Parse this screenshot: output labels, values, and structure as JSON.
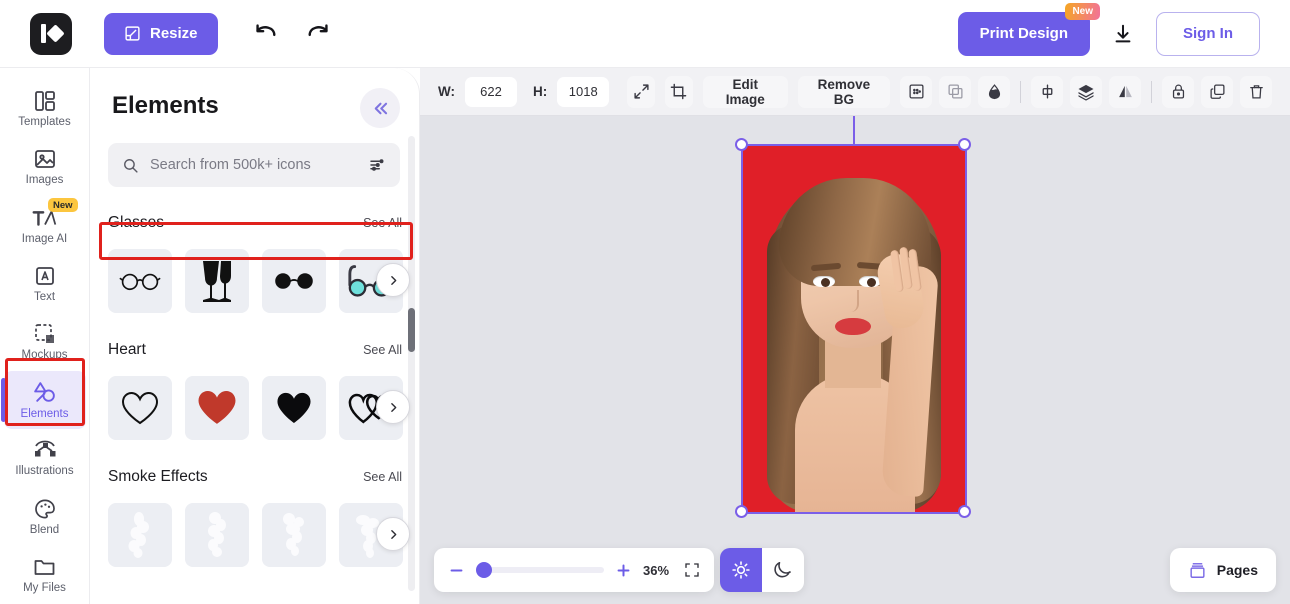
{
  "topbar": {
    "logo_name": "app-logo",
    "resize_label": "Resize",
    "undo_icon": "undo-icon",
    "redo_icon": "redo-icon",
    "print_label": "Print Design",
    "print_badge": "New",
    "download_icon": "download-icon",
    "signin_label": "Sign In"
  },
  "rail": {
    "items": [
      {
        "label": "Templates",
        "icon": "templates-icon",
        "active": false,
        "badge": ""
      },
      {
        "label": "Images",
        "icon": "images-icon",
        "active": false,
        "badge": ""
      },
      {
        "label": "Image AI",
        "icon": "image-ai-icon",
        "active": false,
        "badge": "New"
      },
      {
        "label": "Text",
        "icon": "text-icon",
        "active": false,
        "badge": ""
      },
      {
        "label": "Mockups",
        "icon": "mockups-icon",
        "active": false,
        "badge": ""
      },
      {
        "label": "Elements",
        "icon": "elements-icon",
        "active": true,
        "badge": ""
      },
      {
        "label": "Illustrations",
        "icon": "illustrations-icon",
        "active": false,
        "badge": ""
      },
      {
        "label": "Blend",
        "icon": "blend-icon",
        "active": false,
        "badge": ""
      },
      {
        "label": "My Files",
        "icon": "my-files-icon",
        "active": false,
        "badge": ""
      }
    ]
  },
  "panel": {
    "title": "Elements",
    "collapse_icon": "double-chevron-left-icon",
    "search": {
      "placeholder": "Search from 500k+ icons",
      "value": "",
      "search_icon": "search-icon",
      "filter_icon": "filter-sliders-icon"
    },
    "sections": [
      {
        "name": "Glasses",
        "see_all": "See All",
        "tiles": [
          "round-glasses-icon",
          "wine-glasses-icon",
          "sunglasses-icon",
          "cyan-glasses-icon"
        ]
      },
      {
        "name": "Heart",
        "see_all": "See All",
        "tiles": [
          "heart-outline-icon",
          "heart-red-icon",
          "heart-black-icon",
          "double-heart-icon"
        ]
      },
      {
        "name": "Smoke Effects",
        "see_all": "See All",
        "tiles": [
          "smoke-1-icon",
          "smoke-2-icon",
          "smoke-3-icon",
          "smoke-4-icon"
        ]
      }
    ]
  },
  "canvas_toolbar": {
    "width_label": "W:",
    "width_value": "622",
    "height_label": "H:",
    "height_value": "1018",
    "expand_icon": "expand-arrows-icon",
    "crop_icon": "crop-icon",
    "edit_image_label": "Edit Image",
    "remove_bg_label": "Remove BG",
    "right_icons": [
      "shadow-icon",
      "duplicate-overlap-icon",
      "opacity-droplet-icon",
      "align-icon",
      "layers-icon",
      "flip-icon",
      "lock-icon",
      "copy-icon",
      "trash-icon"
    ]
  },
  "canvas": {
    "background_color": "#e2e3e8",
    "artboard_color": "#e01f28",
    "selection_color": "#7b5fe8",
    "subject": "woman-portrait-image"
  },
  "bottom": {
    "zoom_out_icon": "minus-icon",
    "zoom_in_icon": "plus-icon",
    "zoom_value": "36%",
    "fit_icon": "fit-screen-icon",
    "light_mode_icon": "sun-icon",
    "dark_mode_icon": "moon-icon",
    "pages_label": "Pages",
    "pages_icon": "pages-stack-icon"
  },
  "colors": {
    "accent": "#6c5ce7",
    "accent_light": "#ebe8fb",
    "annotation": "#e0211c",
    "badge_yellow": "#fcc63f",
    "heart_red": "#c0392b",
    "cyan_lens": "#6fe0dc"
  }
}
